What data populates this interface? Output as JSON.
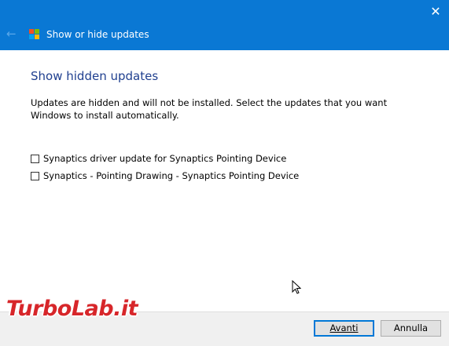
{
  "window": {
    "title": "Show or hide updates",
    "close_label": "✕",
    "back_label": "←"
  },
  "main": {
    "heading": "Show hidden updates",
    "description": "Updates are hidden and will not be installed. Select the updates that you want Windows to install automatically.",
    "updates": [
      {
        "label": "Synaptics driver update for Synaptics Pointing Device",
        "checked": false
      },
      {
        "label": "Synaptics - Pointing Drawing - Synaptics Pointing Device",
        "checked": false
      }
    ]
  },
  "footer": {
    "next_label": "Avanti",
    "cancel_label": "Annulla"
  },
  "watermark": {
    "text": "TurboLab.it"
  },
  "colors": {
    "titlebar": "#0a78d4",
    "heading": "#1f3f8f",
    "watermark": "#d7262a"
  },
  "icons": [
    "back-arrow-icon",
    "windows-logo-icon",
    "close-icon",
    "mouse-cursor-icon"
  ]
}
